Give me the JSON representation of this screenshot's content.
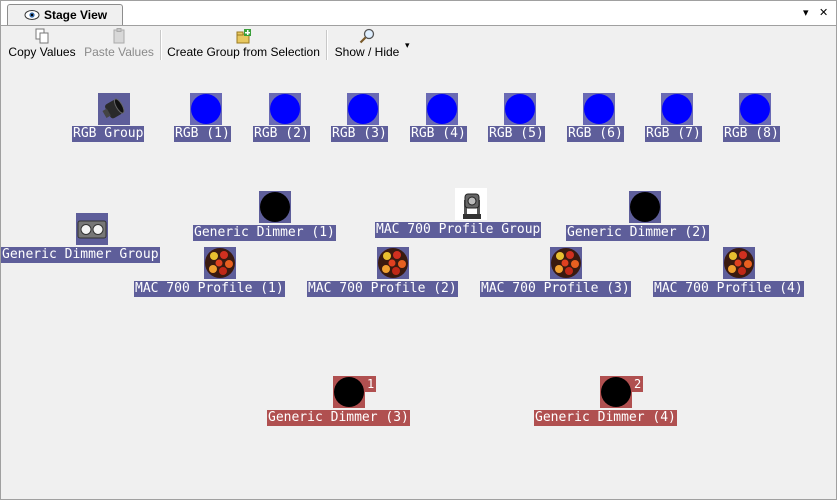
{
  "tab": {
    "title": "Stage View",
    "icon": "eye-icon"
  },
  "window_controls": {
    "dropdown": "▾",
    "close": "✕"
  },
  "toolbar": {
    "copy_values": "Copy Values",
    "paste_values": "Paste Values",
    "create_group": "Create Group from Selection",
    "show_hide": "Show / Hide",
    "dropdown_arrow": "▾"
  },
  "stage": {
    "rgb_group": "RGB Group",
    "rgb": [
      "RGB (1)",
      "RGB (2)",
      "RGB (3)",
      "RGB (4)",
      "RGB (5)",
      "RGB (6)",
      "RGB (7)",
      "RGB (8)"
    ],
    "generic_dimmer_group": "Generic Dimmer Group",
    "generic_dimmer_1": "Generic Dimmer (1)",
    "mac700_group": "MAC 700 Profile Group",
    "generic_dimmer_2": "Generic Dimmer (2)",
    "mac700": [
      "MAC 700 Profile (1)",
      "MAC 700 Profile (2)",
      "MAC 700 Profile (3)",
      "MAC 700 Profile (4)"
    ],
    "generic_dimmer_3": "Generic Dimmer (3)",
    "generic_dimmer_4": "Generic Dimmer (4)",
    "badge_3": "1",
    "badge_4": "2"
  },
  "colors": {
    "selected_label": "#5e5e9a",
    "highlight_label": "#b05050",
    "rgb_fixture": "#0000ff"
  }
}
